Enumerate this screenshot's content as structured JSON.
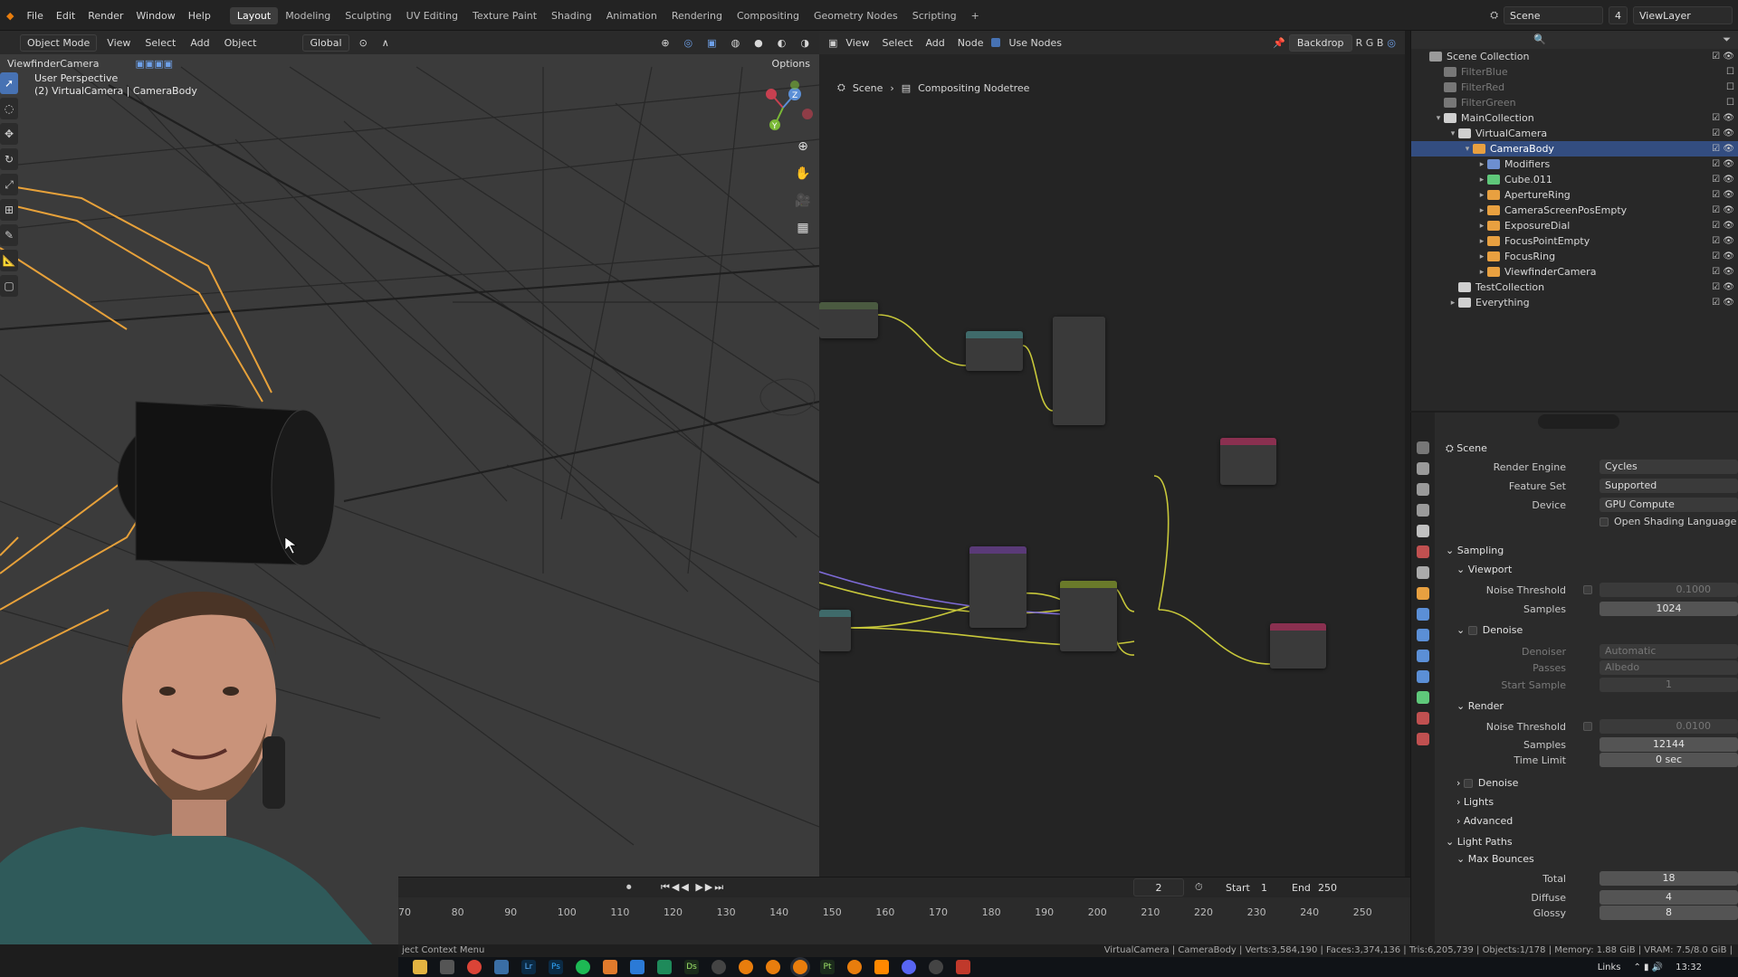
{
  "menu": [
    "File",
    "Edit",
    "Render",
    "Window",
    "Help"
  ],
  "workspaces": [
    "Layout",
    "Modeling",
    "Sculpting",
    "UV Editing",
    "Texture Paint",
    "Shading",
    "Animation",
    "Rendering",
    "Compositing",
    "Geometry Nodes",
    "Scripting",
    "+"
  ],
  "active_workspace": "Layout",
  "top_right": {
    "scene": "Scene",
    "viewlayer": "ViewLayer",
    "scene_count": "4"
  },
  "viewport": {
    "mode": "Object Mode",
    "menus": [
      "View",
      "Select",
      "Add",
      "Object"
    ],
    "transform": "Global",
    "camera_label": "ViewfinderCamera",
    "options": "Options",
    "perspective": "User Perspective",
    "object_info": "(2) VirtualCamera | CameraBody",
    "gizmo_z": "Z",
    "gizmo_y": "Y"
  },
  "node_editor": {
    "menus": [
      "View",
      "Select",
      "Add",
      "Node"
    ],
    "use_nodes": "Use Nodes",
    "backdrop": "Backdrop",
    "channels": "R G B",
    "breadcrumb_scene": "Scene",
    "breadcrumb_tree": "Compositing Nodetree"
  },
  "outliner": {
    "rows": [
      {
        "label": "Scene Collection",
        "indent": 0,
        "tri": "",
        "color": "#9a9a9a"
      },
      {
        "label": "FilterBlue",
        "indent": 1,
        "tri": "",
        "color": "#777",
        "dim": true
      },
      {
        "label": "FilterRed",
        "indent": 1,
        "tri": "",
        "color": "#777",
        "dim": true
      },
      {
        "label": "FilterGreen",
        "indent": 1,
        "tri": "",
        "color": "#777",
        "dim": true
      },
      {
        "label": "MainCollection",
        "indent": 1,
        "tri": "▾",
        "color": "#cfcfcf"
      },
      {
        "label": "VirtualCamera",
        "indent": 2,
        "tri": "▾",
        "color": "#cfcfcf"
      },
      {
        "label": "CameraBody",
        "indent": 3,
        "tri": "▾",
        "color": "#e8a040",
        "selected": true
      },
      {
        "label": "Modifiers",
        "indent": 4,
        "tri": "▸",
        "color": "#6d8fd0"
      },
      {
        "label": "Cube.011",
        "indent": 4,
        "tri": "▸",
        "color": "#5fc87a"
      },
      {
        "label": "ApertureRing",
        "indent": 4,
        "tri": "▸",
        "color": "#e8a040"
      },
      {
        "label": "CameraScreenPosEmpty",
        "indent": 4,
        "tri": "▸",
        "color": "#e8a040"
      },
      {
        "label": "ExposureDial",
        "indent": 4,
        "tri": "▸",
        "color": "#e8a040"
      },
      {
        "label": "FocusPointEmpty",
        "indent": 4,
        "tri": "▸",
        "color": "#e8a040"
      },
      {
        "label": "FocusRing",
        "indent": 4,
        "tri": "▸",
        "color": "#e8a040"
      },
      {
        "label": "ViewfinderCamera",
        "indent": 4,
        "tri": "▸",
        "color": "#e8a040"
      },
      {
        "label": "TestCollection",
        "indent": 2,
        "tri": "",
        "color": "#cfcfcf"
      },
      {
        "label": "Everything",
        "indent": 2,
        "tri": "▸",
        "color": "#cfcfcf"
      }
    ]
  },
  "properties": {
    "title": "Scene",
    "render_engine_label": "Render Engine",
    "render_engine": "Cycles",
    "feature_set_label": "Feature Set",
    "feature_set": "Supported",
    "device_label": "Device",
    "device": "GPU Compute",
    "osl": "Open Shading Language",
    "sampling": "Sampling",
    "viewport": "Viewport",
    "noise_threshold_label": "Noise Threshold",
    "vp_noise_threshold": "0.1000",
    "samples_label": "Samples",
    "vp_samples": "1024",
    "denoise": "Denoise",
    "denoiser_label": "Denoiser",
    "denoiser": "Automatic",
    "passes_label": "Passes",
    "passes": "Albedo",
    "start_sample_label": "Start Sample",
    "start_sample": "1",
    "render": "Render",
    "r_noise_threshold": "0.0100",
    "r_samples": "12144",
    "time_limit_label": "Time Limit",
    "time_limit": "0 sec",
    "lights": "Lights",
    "advanced": "Advanced",
    "light_paths": "Light Paths",
    "max_bounces": "Max Bounces",
    "total_label": "Total",
    "total": "18",
    "diffuse_label": "Diffuse",
    "diffuse": "4",
    "glossy_label": "Glossy",
    "glossy": "8"
  },
  "timeline": {
    "current_frame": "2",
    "start_label": "Start",
    "start": "1",
    "end_label": "End",
    "end": "250",
    "ticks": [
      "70",
      "80",
      "90",
      "100",
      "110",
      "120",
      "130",
      "140",
      "150",
      "160",
      "170",
      "180",
      "190",
      "200",
      "210",
      "220",
      "230",
      "240",
      "250"
    ]
  },
  "status": {
    "left": "ject Context Menu",
    "right": "VirtualCamera | CameraBody | Verts:3,584,190 | Faces:3,374,136 | Tris:6,205,739 | Objects:1/178 | Memory: 1.88 GiB | VRAM: 7.5/8.0 GiB |"
  },
  "taskbar": {
    "apps": [
      "Lr",
      "Ps",
      "Ds",
      "Pt"
    ],
    "links": "Links",
    "time": "13:32"
  }
}
